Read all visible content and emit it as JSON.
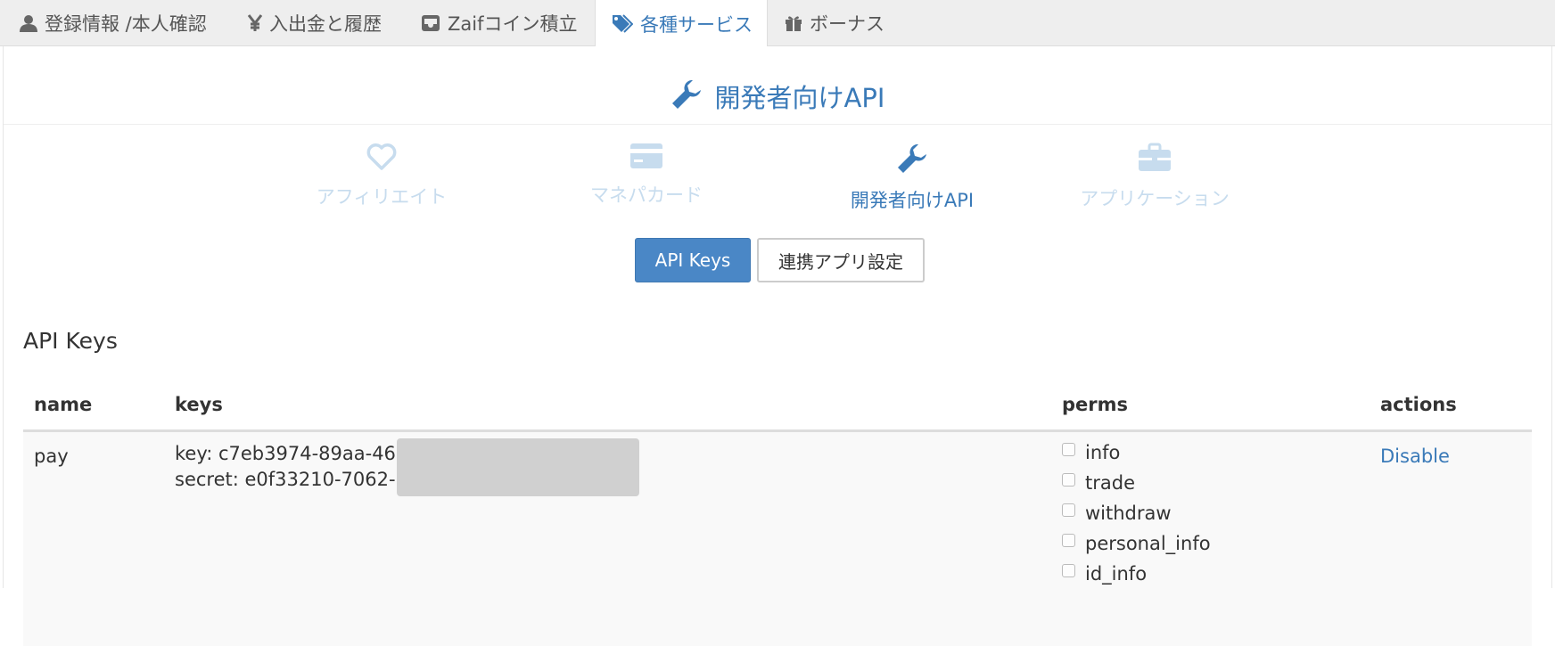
{
  "tabs": [
    {
      "label": "登録情報 /本人確認",
      "icon": "user-icon",
      "active": false
    },
    {
      "label": "入出金と履歴",
      "icon": "yen-icon",
      "active": false
    },
    {
      "label": "Zaifコイン積立",
      "icon": "inbox-icon",
      "active": false
    },
    {
      "label": "各種サービス",
      "icon": "tags-icon",
      "active": true
    },
    {
      "label": "ボーナス",
      "icon": "gift-icon",
      "active": false
    }
  ],
  "page_title": "開発者向けAPI",
  "services": [
    {
      "label": "アフィリエイト",
      "icon": "heart-icon",
      "active": false
    },
    {
      "label": "マネパカード",
      "icon": "credit-card-icon",
      "active": false
    },
    {
      "label": "開発者向けAPI",
      "icon": "wrench-icon",
      "active": true
    },
    {
      "label": "アプリケーション",
      "icon": "briefcase-icon",
      "active": false
    }
  ],
  "buttons": {
    "api_keys": "API Keys",
    "linked_apps": "連携アプリ設定"
  },
  "section_title": "API Keys",
  "table": {
    "headers": [
      "name",
      "keys",
      "perms",
      "actions"
    ],
    "rows": [
      {
        "name": "pay",
        "key_line": "key: c7eb3974-89aa-46",
        "secret_line": "secret: e0f33210-7062-",
        "perms": [
          "info",
          "trade",
          "withdraw",
          "personal_info",
          "id_info"
        ],
        "action": "Disable"
      }
    ]
  },
  "colors": {
    "accent": "#3a7ab8",
    "inactive_service": "#c7dcee",
    "primary_button": "#4a87c6"
  }
}
